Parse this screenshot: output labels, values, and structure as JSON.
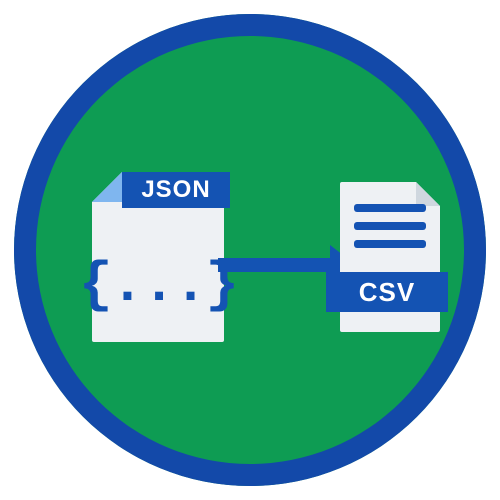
{
  "diagram": {
    "source_format_label": "JSON",
    "source_body_glyph": "{...}",
    "target_format_label": "CSV",
    "colors": {
      "ring": "#1349a9",
      "background": "#0e9c53",
      "accent": "#1453b3",
      "fold_light": "#7fb6ef",
      "paper": "#eef1f4"
    }
  }
}
